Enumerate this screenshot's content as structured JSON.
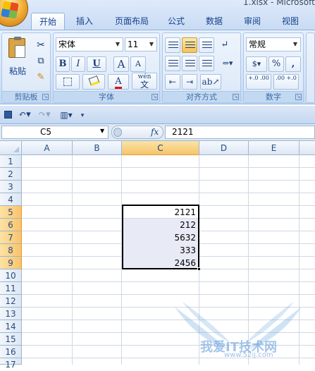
{
  "window": {
    "title": "1.xlsx - Microsoft"
  },
  "tabs": [
    {
      "label": "开始",
      "active": true
    },
    {
      "label": "插入"
    },
    {
      "label": "页面布局"
    },
    {
      "label": "公式"
    },
    {
      "label": "数据"
    },
    {
      "label": "审阅"
    },
    {
      "label": "视图"
    }
  ],
  "ribbon": {
    "clipboard": {
      "paste_label": "粘贴",
      "group_label": "剪贴板"
    },
    "font": {
      "font_name": "宋体",
      "font_size": "11",
      "bold": "B",
      "italic": "I",
      "underline": "U",
      "grow": "A",
      "shrink": "A",
      "font_color_glyph": "A",
      "phonetic": "wén",
      "phonetic_char": "文",
      "group_label": "字体"
    },
    "alignment": {
      "group_label": "对齐方式"
    },
    "number": {
      "format": "常规",
      "percent": "%",
      "comma": ",",
      "inc_decimal": "+.0 .00",
      "dec_decimal": ".00 +.0",
      "group_label": "数字"
    }
  },
  "formula_bar": {
    "name_box": "C5",
    "fx": "fx",
    "formula": "2121"
  },
  "sheet": {
    "columns": [
      "A",
      "B",
      "C",
      "D",
      "E"
    ],
    "active_column": "C",
    "rows": [
      "1",
      "2",
      "3",
      "4",
      "5",
      "6",
      "7",
      "8",
      "9",
      "10",
      "11",
      "12",
      "13",
      "14",
      "15",
      "16",
      "17"
    ],
    "active_rows": [
      "5",
      "6",
      "7",
      "8",
      "9"
    ],
    "cells": [
      {
        "ref": "C5",
        "value": "2121"
      },
      {
        "ref": "C6",
        "value": "212"
      },
      {
        "ref": "C7",
        "value": "5632"
      },
      {
        "ref": "C8",
        "value": "333"
      },
      {
        "ref": "C9",
        "value": "2456"
      }
    ]
  },
  "watermark": {
    "text": "我爱IT技术网",
    "url": "www.52ij.com"
  },
  "colors": {
    "ribbon": "#dbe8f8",
    "active_header": "#f7c46a",
    "selection_border": "#000000"
  }
}
